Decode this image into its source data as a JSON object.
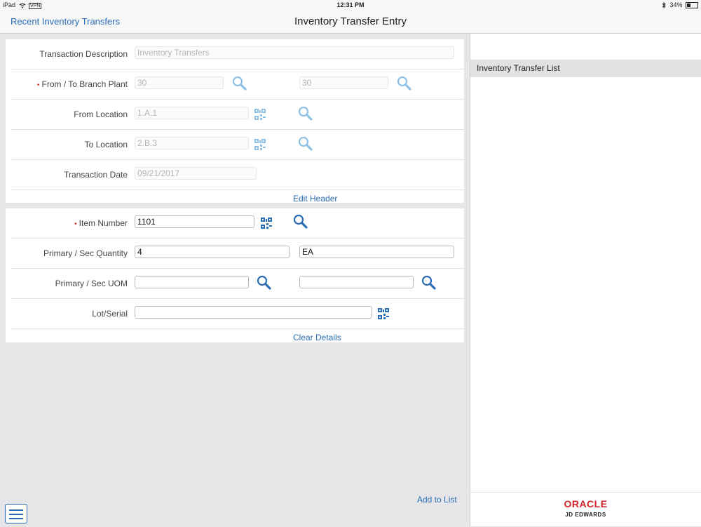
{
  "status_bar": {
    "device": "iPad",
    "vpn": "VPN",
    "time": "12:31 PM",
    "battery": "34%",
    "battery_level": 0.34
  },
  "nav": {
    "back_label": "Recent Inventory Transfers",
    "title": "Inventory Transfer Entry"
  },
  "header": {
    "transaction_description": {
      "label": "Transaction Description",
      "value": "Inventory Transfers"
    },
    "branch_plant": {
      "label": "From / To Branch Plant",
      "from_value": "30",
      "to_value": "30",
      "required": "•"
    },
    "from_location": {
      "label": "From Location",
      "value": "1.A.1"
    },
    "to_location": {
      "label": "To Location",
      "value": "2.B.3"
    },
    "transaction_date": {
      "label": "Transaction Date",
      "value": "09/21/2017"
    },
    "edit_header_label": "Edit Header"
  },
  "details": {
    "item_number": {
      "label": "Item Number",
      "value": "1101",
      "required": "•"
    },
    "quantity": {
      "label": "Primary / Sec Quantity",
      "primary_value": "4",
      "secondary_value": "EA"
    },
    "uom": {
      "label": "Primary / Sec UOM",
      "primary_value": "",
      "secondary_value": ""
    },
    "lot_serial": {
      "label": "Lot/Serial",
      "value": ""
    },
    "clear_details_label": "Clear Details"
  },
  "actions": {
    "add_to_list_label": "Add to List"
  },
  "right_panel": {
    "list_title": "Inventory Transfer List"
  },
  "branding": {
    "oracle": "ORACLE",
    "jde": "JD EDWARDS"
  },
  "colors": {
    "accent": "#2a6db5",
    "icon_blue": "#2a6db5",
    "icon_disabled": "#8fc0e6",
    "required": "#d0342c",
    "oracle_red": "#d2232a"
  }
}
